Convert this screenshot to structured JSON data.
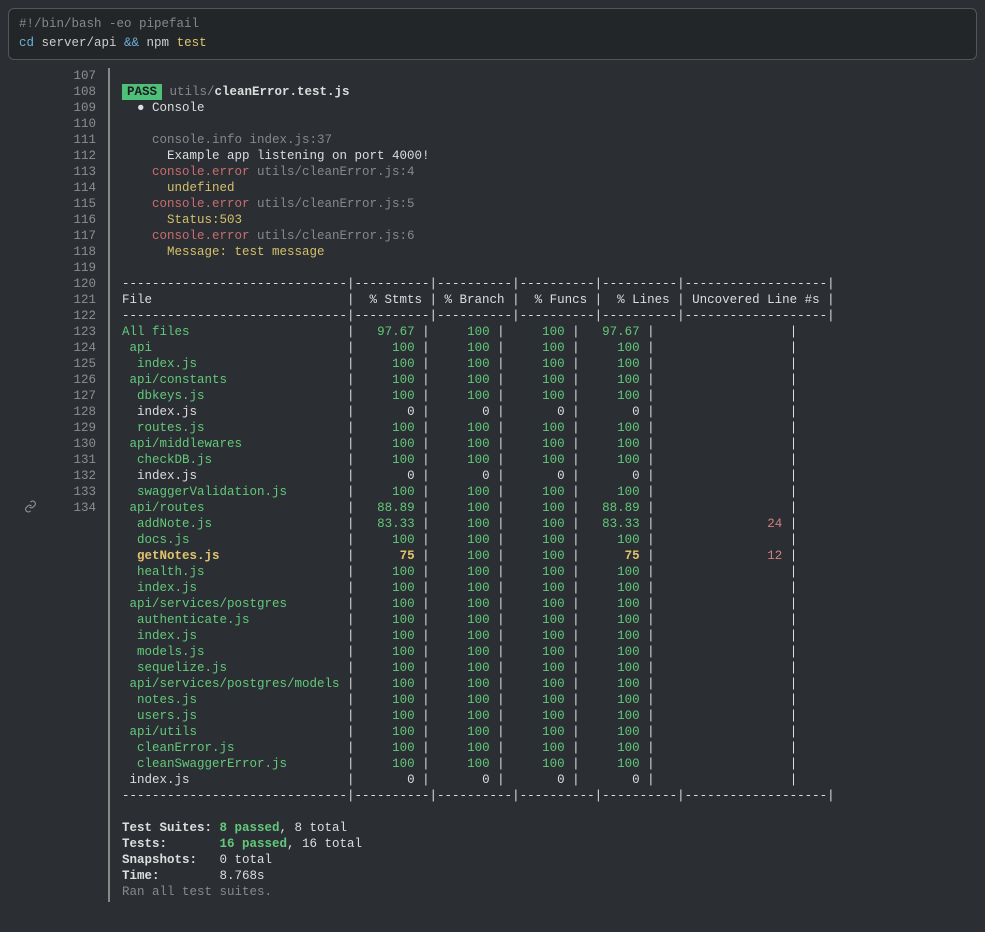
{
  "command": {
    "shebang": "#!/bin/bash -eo pipefail",
    "cd": "cd",
    "path": " server/api ",
    "amp": "&&",
    "npm": " npm ",
    "test": "test"
  },
  "lines": {
    "start": 107,
    "end": 134
  },
  "pass": {
    "badge": "PASS",
    "dir": " utils/",
    "file": "cleanError.test.js"
  },
  "console_header": "  ● Console",
  "log": {
    "info_src": "    console.info index.js:37",
    "info_msg": "      Example app listening on port 4000!",
    "e1_src": "    console.error utils/cleanError.js:4",
    "e1_msg": "      undefined",
    "e2_src": "    console.error utils/cleanError.js:5",
    "e2_msg": "      Status:503",
    "e3_src": "    console.error utils/cleanError.js:6",
    "e3_msg": "      Message: test message"
  },
  "table": {
    "sep": "------------------------------|----------|----------|----------|----------|-------------------|",
    "header": "File                          |  % Stmts | % Branch |  % Funcs |  % Lines | Uncovered Line #s |",
    "rows": [
      {
        "file": "All files                    ",
        "s": "   97.67",
        "b": "     100",
        "f": "     100",
        "l": "   97.67",
        "u": "                  ",
        "cf": "fgreen",
        "cs": "fgreen",
        "cb": "fgreen",
        "cff": "fgreen",
        "cl": "fgreen",
        "cu": ""
      },
      {
        "file": " api                         ",
        "s": "     100",
        "b": "     100",
        "f": "     100",
        "l": "     100",
        "u": "                  ",
        "cf": "fgreen",
        "cs": "fgreen",
        "cb": "fgreen",
        "cff": "fgreen",
        "cl": "fgreen",
        "cu": ""
      },
      {
        "file": "  index.js                   ",
        "s": "     100",
        "b": "     100",
        "f": "     100",
        "l": "     100",
        "u": "                  ",
        "cf": "fgreen",
        "cs": "fgreen",
        "cb": "fgreen",
        "cff": "fgreen",
        "cl": "fgreen",
        "cu": ""
      },
      {
        "file": " api/constants               ",
        "s": "     100",
        "b": "     100",
        "f": "     100",
        "l": "     100",
        "u": "                  ",
        "cf": "fgreen",
        "cs": "fgreen",
        "cb": "fgreen",
        "cff": "fgreen",
        "cl": "fgreen",
        "cu": ""
      },
      {
        "file": "  dbkeys.js                  ",
        "s": "     100",
        "b": "     100",
        "f": "     100",
        "l": "     100",
        "u": "                  ",
        "cf": "fgreen",
        "cs": "fgreen",
        "cb": "fgreen",
        "cff": "fgreen",
        "cl": "fgreen",
        "cu": ""
      },
      {
        "file": "  index.js                   ",
        "s": "       0",
        "b": "       0",
        "f": "       0",
        "l": "       0",
        "u": "                  ",
        "cf": "white",
        "cs": "white",
        "cb": "white",
        "cff": "white",
        "cl": "white",
        "cu": ""
      },
      {
        "file": "  routes.js                  ",
        "s": "     100",
        "b": "     100",
        "f": "     100",
        "l": "     100",
        "u": "                  ",
        "cf": "fgreen",
        "cs": "fgreen",
        "cb": "fgreen",
        "cff": "fgreen",
        "cl": "fgreen",
        "cu": ""
      },
      {
        "file": " api/middlewares             ",
        "s": "     100",
        "b": "     100",
        "f": "     100",
        "l": "     100",
        "u": "                  ",
        "cf": "fgreen",
        "cs": "fgreen",
        "cb": "fgreen",
        "cff": "fgreen",
        "cl": "fgreen",
        "cu": ""
      },
      {
        "file": "  checkDB.js                 ",
        "s": "     100",
        "b": "     100",
        "f": "     100",
        "l": "     100",
        "u": "                  ",
        "cf": "fgreen",
        "cs": "fgreen",
        "cb": "fgreen",
        "cff": "fgreen",
        "cl": "fgreen",
        "cu": ""
      },
      {
        "file": "  index.js                   ",
        "s": "       0",
        "b": "       0",
        "f": "       0",
        "l": "       0",
        "u": "                  ",
        "cf": "white",
        "cs": "white",
        "cb": "white",
        "cff": "white",
        "cl": "white",
        "cu": ""
      },
      {
        "file": "  swaggerValidation.js       ",
        "s": "     100",
        "b": "     100",
        "f": "     100",
        "l": "     100",
        "u": "                  ",
        "cf": "fgreen",
        "cs": "fgreen",
        "cb": "fgreen",
        "cff": "fgreen",
        "cl": "fgreen",
        "cu": ""
      },
      {
        "file": " api/routes                  ",
        "s": "   88.89",
        "b": "     100",
        "f": "     100",
        "l": "   88.89",
        "u": "                  ",
        "cf": "fgreen",
        "cs": "fgreen",
        "cb": "fgreen",
        "cff": "fgreen",
        "cl": "fgreen",
        "cu": ""
      },
      {
        "file": "  addNote.js                 ",
        "s": "   83.33",
        "b": "     100",
        "f": "     100",
        "l": "   83.33",
        "u": "               24 ",
        "cf": "fgreen",
        "cs": "fgreen",
        "cb": "fgreen",
        "cff": "fgreen",
        "cl": "fgreen",
        "cu": "red"
      },
      {
        "file": "  docs.js                    ",
        "s": "     100",
        "b": "     100",
        "f": "     100",
        "l": "     100",
        "u": "                  ",
        "cf": "fgreen",
        "cs": "fgreen",
        "cb": "fgreen",
        "cff": "fgreen",
        "cl": "fgreen",
        "cu": ""
      },
      {
        "file": "  getNotes.js                ",
        "s": "      75",
        "b": "     100",
        "f": "     100",
        "l": "      75",
        "u": "               12 ",
        "cf": "fyellow",
        "cs": "fyellow",
        "cb": "fgreen",
        "cff": "fgreen",
        "cl": "fyellow",
        "cu": "red"
      },
      {
        "file": "  health.js                  ",
        "s": "     100",
        "b": "     100",
        "f": "     100",
        "l": "     100",
        "u": "                  ",
        "cf": "fgreen",
        "cs": "fgreen",
        "cb": "fgreen",
        "cff": "fgreen",
        "cl": "fgreen",
        "cu": ""
      },
      {
        "file": "  index.js                   ",
        "s": "     100",
        "b": "     100",
        "f": "     100",
        "l": "     100",
        "u": "                  ",
        "cf": "fgreen",
        "cs": "fgreen",
        "cb": "fgreen",
        "cff": "fgreen",
        "cl": "fgreen",
        "cu": ""
      },
      {
        "file": " api/services/postgres       ",
        "s": "     100",
        "b": "     100",
        "f": "     100",
        "l": "     100",
        "u": "                  ",
        "cf": "fgreen",
        "cs": "fgreen",
        "cb": "fgreen",
        "cff": "fgreen",
        "cl": "fgreen",
        "cu": ""
      },
      {
        "file": "  authenticate.js            ",
        "s": "     100",
        "b": "     100",
        "f": "     100",
        "l": "     100",
        "u": "                  ",
        "cf": "fgreen",
        "cs": "fgreen",
        "cb": "fgreen",
        "cff": "fgreen",
        "cl": "fgreen",
        "cu": ""
      },
      {
        "file": "  index.js                   ",
        "s": "     100",
        "b": "     100",
        "f": "     100",
        "l": "     100",
        "u": "                  ",
        "cf": "fgreen",
        "cs": "fgreen",
        "cb": "fgreen",
        "cff": "fgreen",
        "cl": "fgreen",
        "cu": ""
      },
      {
        "file": "  models.js                  ",
        "s": "     100",
        "b": "     100",
        "f": "     100",
        "l": "     100",
        "u": "                  ",
        "cf": "fgreen",
        "cs": "fgreen",
        "cb": "fgreen",
        "cff": "fgreen",
        "cl": "fgreen",
        "cu": ""
      },
      {
        "file": "  sequelize.js               ",
        "s": "     100",
        "b": "     100",
        "f": "     100",
        "l": "     100",
        "u": "                  ",
        "cf": "fgreen",
        "cs": "fgreen",
        "cb": "fgreen",
        "cff": "fgreen",
        "cl": "fgreen",
        "cu": ""
      },
      {
        "file": " api/services/postgres/models",
        "s": "     100",
        "b": "     100",
        "f": "     100",
        "l": "     100",
        "u": "                  ",
        "cf": "fgreen",
        "cs": "fgreen",
        "cb": "fgreen",
        "cff": "fgreen",
        "cl": "fgreen",
        "cu": ""
      },
      {
        "file": "  notes.js                   ",
        "s": "     100",
        "b": "     100",
        "f": "     100",
        "l": "     100",
        "u": "                  ",
        "cf": "fgreen",
        "cs": "fgreen",
        "cb": "fgreen",
        "cff": "fgreen",
        "cl": "fgreen",
        "cu": ""
      },
      {
        "file": "  users.js                   ",
        "s": "     100",
        "b": "     100",
        "f": "     100",
        "l": "     100",
        "u": "                  ",
        "cf": "fgreen",
        "cs": "fgreen",
        "cb": "fgreen",
        "cff": "fgreen",
        "cl": "fgreen",
        "cu": ""
      },
      {
        "file": " api/utils                   ",
        "s": "     100",
        "b": "     100",
        "f": "     100",
        "l": "     100",
        "u": "                  ",
        "cf": "fgreen",
        "cs": "fgreen",
        "cb": "fgreen",
        "cff": "fgreen",
        "cl": "fgreen",
        "cu": ""
      },
      {
        "file": "  cleanError.js              ",
        "s": "     100",
        "b": "     100",
        "f": "     100",
        "l": "     100",
        "u": "                  ",
        "cf": "fgreen",
        "cs": "fgreen",
        "cb": "fgreen",
        "cff": "fgreen",
        "cl": "fgreen",
        "cu": ""
      },
      {
        "file": "  cleanSwaggerError.js       ",
        "s": "     100",
        "b": "     100",
        "f": "     100",
        "l": "     100",
        "u": "                  ",
        "cf": "fgreen",
        "cs": "fgreen",
        "cb": "fgreen",
        "cff": "fgreen",
        "cl": "fgreen",
        "cu": ""
      },
      {
        "file": " index.js                    ",
        "s": "       0",
        "b": "       0",
        "f": "       0",
        "l": "       0",
        "u": "                  ",
        "cf": "white",
        "cs": "white",
        "cb": "white",
        "cff": "white",
        "cl": "white",
        "cu": ""
      }
    ]
  },
  "summary": {
    "suites_label": "Test Suites: ",
    "suites_pass": "8 passed",
    "suites_total": ", 8 total",
    "tests_label": "Tests:       ",
    "tests_pass": "16 passed",
    "tests_total": ", 16 total",
    "snap_label": "Snapshots:   ",
    "snap_val": "0 total",
    "time_label": "Time:        ",
    "time_val": "8.768s",
    "ran": "Ran all test suites."
  },
  "chart_data": {
    "type": "table",
    "title": "Jest Coverage Summary",
    "columns": [
      "File",
      "% Stmts",
      "% Branch",
      "% Funcs",
      "% Lines",
      "Uncovered Line #s"
    ],
    "rows": [
      [
        "All files",
        97.67,
        100,
        100,
        97.67,
        ""
      ],
      [
        "api",
        100,
        100,
        100,
        100,
        ""
      ],
      [
        "api/index.js",
        100,
        100,
        100,
        100,
        ""
      ],
      [
        "api/constants",
        100,
        100,
        100,
        100,
        ""
      ],
      [
        "api/constants/dbkeys.js",
        100,
        100,
        100,
        100,
        ""
      ],
      [
        "api/constants/index.js",
        0,
        0,
        0,
        0,
        ""
      ],
      [
        "api/constants/routes.js",
        100,
        100,
        100,
        100,
        ""
      ],
      [
        "api/middlewares",
        100,
        100,
        100,
        100,
        ""
      ],
      [
        "api/middlewares/checkDB.js",
        100,
        100,
        100,
        100,
        ""
      ],
      [
        "api/middlewares/index.js",
        0,
        0,
        0,
        0,
        ""
      ],
      [
        "api/middlewares/swaggerValidation.js",
        100,
        100,
        100,
        100,
        ""
      ],
      [
        "api/routes",
        88.89,
        100,
        100,
        88.89,
        ""
      ],
      [
        "api/routes/addNote.js",
        83.33,
        100,
        100,
        83.33,
        "24"
      ],
      [
        "api/routes/docs.js",
        100,
        100,
        100,
        100,
        ""
      ],
      [
        "api/routes/getNotes.js",
        75,
        100,
        100,
        75,
        "12"
      ],
      [
        "api/routes/health.js",
        100,
        100,
        100,
        100,
        ""
      ],
      [
        "api/routes/index.js",
        100,
        100,
        100,
        100,
        ""
      ],
      [
        "api/services/postgres",
        100,
        100,
        100,
        100,
        ""
      ],
      [
        "api/services/postgres/authenticate.js",
        100,
        100,
        100,
        100,
        ""
      ],
      [
        "api/services/postgres/index.js",
        100,
        100,
        100,
        100,
        ""
      ],
      [
        "api/services/postgres/models.js",
        100,
        100,
        100,
        100,
        ""
      ],
      [
        "api/services/postgres/sequelize.js",
        100,
        100,
        100,
        100,
        ""
      ],
      [
        "api/services/postgres/models",
        100,
        100,
        100,
        100,
        ""
      ],
      [
        "api/services/postgres/models/notes.js",
        100,
        100,
        100,
        100,
        ""
      ],
      [
        "api/services/postgres/models/users.js",
        100,
        100,
        100,
        100,
        ""
      ],
      [
        "api/utils",
        100,
        100,
        100,
        100,
        ""
      ],
      [
        "api/utils/cleanError.js",
        100,
        100,
        100,
        100,
        ""
      ],
      [
        "api/utils/cleanSwaggerError.js",
        100,
        100,
        100,
        100,
        ""
      ],
      [
        "index.js",
        0,
        0,
        0,
        0,
        ""
      ]
    ]
  }
}
